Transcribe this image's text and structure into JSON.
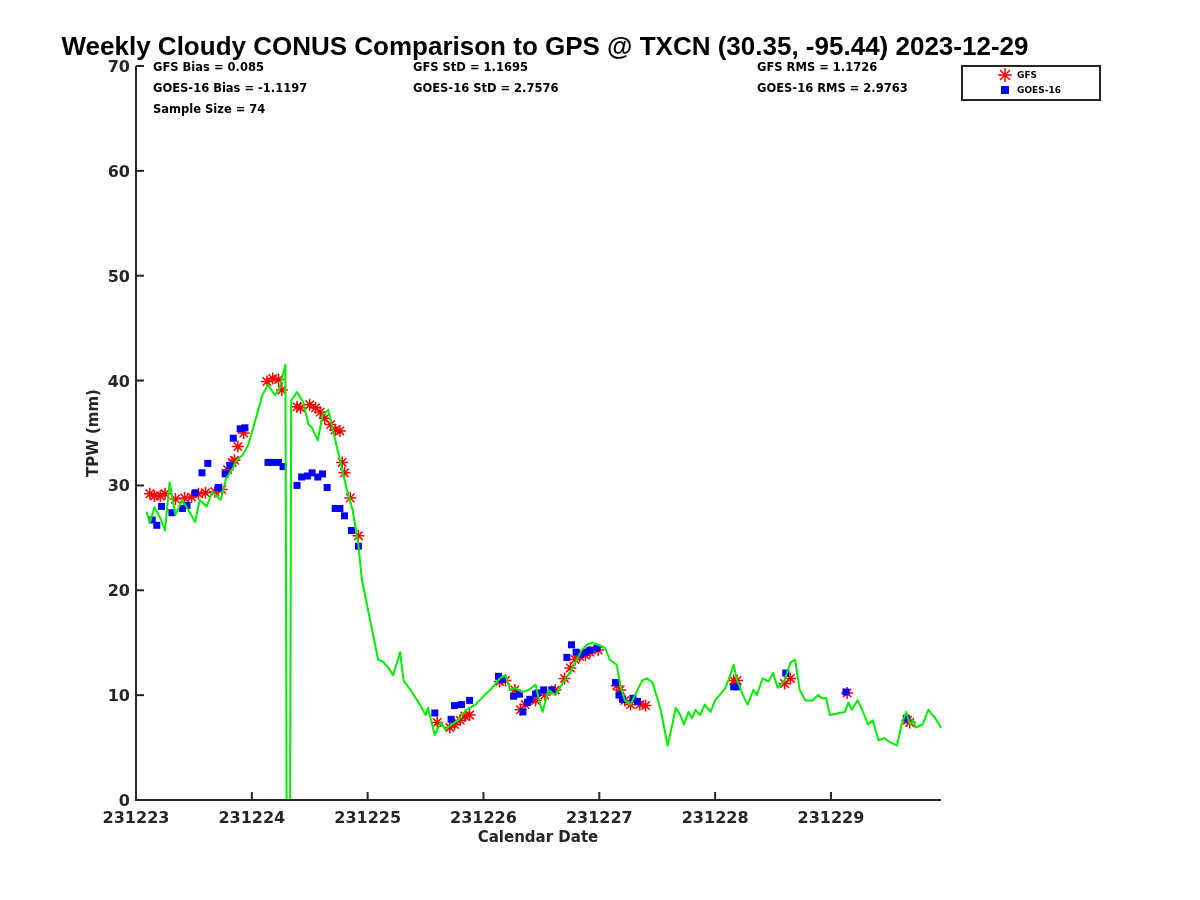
{
  "figure": {
    "statistics": [
      [
        "GFS Bias = 0.085",
        "GOES-16 Bias = -1.1197",
        "Sample Size = 74"
      ],
      [
        "GFS StD = 1.1695",
        "GOES-16 StD = 2.7576"
      ],
      [
        "GFS RMS = 1.1726",
        "GOES-16 RMS = 2.9763"
      ]
    ],
    "chart_data": {
      "type": "scatter",
      "title": "Weekly Cloudy CONUS Comparison to GPS @ TXCN (30.35, -95.44) 2023-12-29",
      "xlabel": "Calendar Date",
      "ylabel": "TPW (mm)",
      "xlim": [
        231223,
        231229.95
      ],
      "ylim": [
        0,
        70
      ],
      "xticks": [
        231223,
        231224,
        231225,
        231226,
        231227,
        231228,
        231229
      ],
      "yticks": [
        0,
        10,
        20,
        30,
        40,
        50,
        60,
        70
      ],
      "legend": "upper right",
      "series": [
        {
          "name": "GFS",
          "color": "#ff0000",
          "type": "scatter",
          "marker": "cross",
          "x": [
            231223.12,
            231223.16,
            231223.21,
            231223.25,
            231223.34,
            231223.42,
            231223.48,
            231223.54,
            231223.6,
            231223.68,
            231223.74,
            231223.79,
            231223.83,
            231223.85,
            231223.88,
            231223.93,
            231224.13,
            231224.18,
            231224.23,
            231224.26,
            231224.39,
            231224.42,
            231224.5,
            231224.55,
            231224.59,
            231224.63,
            231224.68,
            231224.72,
            231224.76,
            231224.78,
            231224.8,
            231224.85,
            231224.92,
            231225.6,
            231225.71,
            231225.75,
            231225.8,
            231225.84,
            231225.88,
            231226.14,
            231226.19,
            231226.27,
            231226.32,
            231226.36,
            231226.45,
            231226.53,
            231226.62,
            231226.7,
            231226.75,
            231226.79,
            231226.83,
            231226.88,
            231226.92,
            231226.99,
            231227.15,
            231227.18,
            231227.22,
            231227.27,
            231227.35,
            231227.4,
            231228.16,
            231228.19,
            231228.6,
            231228.65,
            231229.14,
            231229.66,
            231229.68
          ],
          "values": [
            29.2,
            29.0,
            29.0,
            29.2,
            28.7,
            28.8,
            28.9,
            29.2,
            29.3,
            29.4,
            29.6,
            31.5,
            32.2,
            32.4,
            33.7,
            35.0,
            39.9,
            40.2,
            40.1,
            39.1,
            37.5,
            37.4,
            37.7,
            37.4,
            37.0,
            36.4,
            35.8,
            35.3,
            35.2,
            32.2,
            31.2,
            28.8,
            25.2,
            7.4,
            6.9,
            7.2,
            7.6,
            8.0,
            8.1,
            11.3,
            11.4,
            10.5,
            8.6,
            9.1,
            9.5,
            10.0,
            10.5,
            11.6,
            12.6,
            13.4,
            13.7,
            13.8,
            14.1,
            14.3,
            10.9,
            10.5,
            9.5,
            9.1,
            9.1,
            9.0,
            11.4,
            11.4,
            11.1,
            11.6,
            10.2,
            7.6,
            7.4
          ]
        },
        {
          "name": "GOES-16",
          "color": "#0000ff",
          "type": "scatter",
          "marker": "square",
          "x": [
            231223.14,
            231223.18,
            231223.22,
            231223.31,
            231223.4,
            231223.44,
            231223.51,
            231223.57,
            231223.62,
            231223.71,
            231223.77,
            231223.81,
            231223.84,
            231223.9,
            231223.94,
            231224.14,
            231224.18,
            231224.23,
            231224.27,
            231224.39,
            231224.43,
            231224.48,
            231224.52,
            231224.57,
            231224.61,
            231224.65,
            231224.72,
            231224.76,
            231224.8,
            231224.86,
            231224.92,
            231225.58,
            231225.72,
            231225.75,
            231225.81,
            231225.88,
            231226.13,
            231226.16,
            231226.26,
            231226.31,
            231226.34,
            231226.38,
            231226.4,
            231226.45,
            231226.47,
            231226.52,
            231226.59,
            231226.72,
            231226.76,
            231226.8,
            231226.84,
            231226.88,
            231226.92,
            231226.98,
            231227.14,
            231227.17,
            231227.2,
            231227.29,
            231227.33,
            231228.16,
            231228.19,
            231228.61,
            231229.13,
            231229.65
          ],
          "values": [
            26.7,
            26.2,
            28.0,
            27.4,
            27.8,
            28.1,
            29.3,
            31.2,
            32.1,
            29.8,
            31.1,
            31.9,
            34.5,
            35.4,
            35.5,
            32.2,
            32.2,
            32.2,
            31.8,
            30.0,
            30.8,
            30.9,
            31.2,
            30.8,
            31.1,
            29.8,
            27.8,
            27.8,
            27.1,
            25.7,
            24.2,
            8.3,
            7.7,
            9.0,
            9.1,
            9.5,
            11.8,
            11.5,
            9.9,
            10.1,
            8.4,
            9.3,
            9.6,
            10.1,
            10.2,
            10.5,
            10.5,
            13.6,
            14.8,
            14.1,
            13.9,
            14.1,
            14.3,
            14.5,
            11.2,
            10.0,
            9.6,
            9.7,
            9.4,
            10.8,
            10.8,
            12.1,
            10.3,
            7.8
          ]
        },
        {
          "color": "#00ee00",
          "type": "line",
          "x": [
            231223.09,
            231223.12,
            231223.16,
            231223.21,
            231223.25,
            231223.29,
            231223.34,
            231223.4,
            231223.45,
            231223.51,
            231223.55,
            231223.61,
            231223.66,
            231223.73,
            231223.78,
            231223.83,
            231223.87,
            231223.92,
            231223.97,
            231224.03,
            231224.09,
            231224.14,
            231224.2,
            231224.24,
            231224.29,
            231224.3,
            231224.33,
            231224.34,
            231224.39,
            231224.44,
            231224.49,
            231224.52,
            231224.57,
            231224.61,
            231224.66,
            231224.7,
            231224.74,
            231224.78,
            231224.82,
            231224.87,
            231224.92,
            231224.95,
            231225.02,
            231225.09,
            231225.13,
            231225.18,
            231225.22,
            231225.28,
            231225.31,
            231225.37,
            231225.44,
            231225.5,
            231225.52,
            231225.58,
            231225.63,
            231225.67,
            231225.71,
            231225.78,
            231225.85,
            231225.93,
            231226.01,
            231226.1,
            231226.14,
            231226.19,
            231226.23,
            231226.27,
            231226.33,
            231226.39,
            231226.45,
            231226.49,
            231226.51,
            231226.56,
            231226.62,
            231226.66,
            231226.7,
            231226.77,
            231226.81,
            231226.85,
            231226.89,
            231226.94,
            231226.99,
            231227.05,
            231227.09,
            231227.15,
            231227.18,
            231227.22,
            231227.27,
            231227.33,
            231227.37,
            231227.41,
            231227.46,
            231227.53,
            231227.59,
            231227.63,
            231227.66,
            231227.7,
            231227.73,
            231227.77,
            231227.8,
            231227.83,
            231227.87,
            231227.91,
            231227.96,
            231228.0,
            231228.09,
            231228.13,
            231228.16,
            231228.19,
            231228.24,
            231228.28,
            231228.33,
            231228.36,
            231228.41,
            231228.46,
            231228.5,
            231228.54,
            231228.6,
            231228.65,
            231228.69,
            231228.73,
            231228.78,
            231228.84,
            231228.89,
            231228.92,
            231228.96,
            231228.99,
            231229.12,
            231229.15,
            231229.18,
            231229.23,
            231229.27,
            231229.32,
            231229.36,
            231229.41,
            231229.46,
            231229.51,
            231229.57,
            231229.61,
            231229.65,
            231229.68,
            231229.71,
            231229.73,
            231229.79,
            231229.84,
            231229.9,
            231229.95
          ],
          "values": [
            27.5,
            26.5,
            27.9,
            26.9,
            25.7,
            30.3,
            27.2,
            28.6,
            27.7,
            26.5,
            28.6,
            28.0,
            29.4,
            28.6,
            30.7,
            31.5,
            32.4,
            32.9,
            33.9,
            36.2,
            38.6,
            39.6,
            38.6,
            39.3,
            41.5,
            0,
            0,
            38.1,
            38.9,
            38.0,
            35.8,
            35.5,
            34.3,
            36.7,
            37.2,
            35.3,
            33.4,
            31.5,
            29.6,
            27.7,
            24.3,
            21.0,
            17.2,
            13.4,
            13.2,
            12.6,
            11.9,
            14.1,
            11.4,
            10.5,
            9.3,
            8.1,
            8.8,
            6.2,
            7.4,
            6.7,
            7.1,
            7.6,
            8.6,
            9.1,
            10.0,
            11.0,
            11.6,
            11.9,
            10.5,
            10.7,
            10.3,
            10.5,
            11.0,
            9.1,
            8.4,
            10.5,
            10.0,
            10.7,
            11.4,
            12.6,
            13.5,
            14.3,
            14.8,
            15.0,
            14.8,
            14.5,
            13.4,
            12.9,
            11.0,
            9.5,
            9.1,
            10.5,
            11.4,
            11.6,
            11.2,
            8.6,
            5.2,
            7.2,
            8.8,
            8.1,
            7.2,
            8.4,
            7.8,
            8.6,
            8.1,
            9.1,
            8.4,
            9.5,
            10.7,
            11.9,
            12.9,
            11.4,
            10.0,
            9.1,
            10.5,
            10.0,
            11.6,
            11.3,
            12.1,
            10.7,
            11.4,
            13.1,
            13.4,
            10.5,
            9.5,
            9.5,
            10.0,
            9.7,
            9.7,
            8.1,
            8.4,
            9.3,
            8.6,
            9.5,
            8.6,
            7.2,
            7.6,
            5.7,
            5.9,
            5.5,
            5.2,
            7.2,
            8.4,
            7.2,
            7.6,
            6.9,
            7.2,
            8.6,
            7.8,
            6.9
          ]
        }
      ]
    }
  }
}
